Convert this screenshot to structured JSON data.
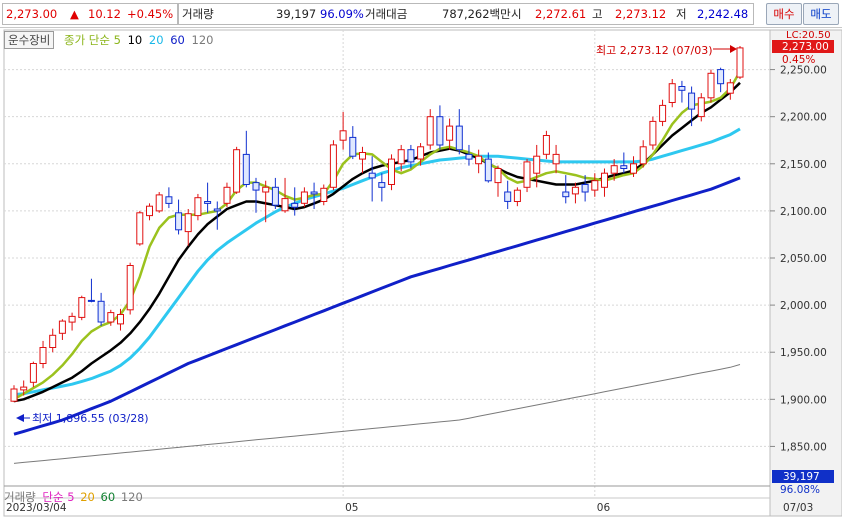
{
  "quote": {
    "price": "2,273.00",
    "arrow": "▲",
    "change": "10.12",
    "change_pct": "+0.45%",
    "volume_label": "거래량",
    "volume": "39,197",
    "volume_ratio": "96.09%",
    "value_label": "거래대금",
    "value": "787,262백만",
    "open_label": "시",
    "open": "2,272.61",
    "high_label": "고",
    "high": "2,273.12",
    "low_label": "저",
    "low": "2,242.48",
    "buy_label": "매수",
    "sell_label": "매도"
  },
  "legend": {
    "sector": "운수장비",
    "price_ma_label": "종가 단순",
    "periods": [
      "5",
      "10",
      "20",
      "60",
      "120"
    ],
    "volume_label": "거래량",
    "volume_ma_label": "단순",
    "volume_periods": [
      "5",
      "20",
      "60",
      "120"
    ]
  },
  "annotations": {
    "high_note": "최고 2,273.12 (07/03)",
    "low_note": "최저 1,896.55 (03/28)",
    "lc_label": "LC:20.50",
    "current_tag": "2,273.00",
    "current_pct": "0.45%",
    "vol_tag": "39,197",
    "vol_pct": "96.08%"
  },
  "colors": {
    "up": "#e01010",
    "down": "#1030d0",
    "ma5": "#9bc21e",
    "ma10": "#000000",
    "ma20": "#2ec8f0",
    "ma60": "#1020c8",
    "ma120": "#7a7a7a"
  },
  "chart_data": {
    "type": "candlestick",
    "title": "운수장비",
    "x_start": "2023/03/04",
    "x_ticks": [
      {
        "label": "2023/03/04",
        "index": 0
      },
      {
        "label": "05",
        "index": 34
      },
      {
        "label": "06",
        "index": 60
      },
      {
        "label": "07",
        "index": 87
      }
    ],
    "x_end_label": "07/03",
    "ylim": [
      1808,
      2292
    ],
    "y_ticks": [
      1850,
      1900,
      1950,
      2000,
      2050,
      2100,
      2150,
      2200,
      2250
    ],
    "y_tick_labels": [
      "1,850.00",
      "1,900.00",
      "1,950.00",
      "2,000.00",
      "2,050.00",
      "2,100.00",
      "2,150.00",
      "2,200.00",
      "2,250.00"
    ],
    "candles": [
      [
        1898,
        1915,
        1897,
        1911
      ],
      [
        1910,
        1920,
        1904,
        1913
      ],
      [
        1918,
        1940,
        1913,
        1938
      ],
      [
        1938,
        1962,
        1933,
        1955
      ],
      [
        1955,
        1975,
        1950,
        1968
      ],
      [
        1970,
        1985,
        1963,
        1983
      ],
      [
        1982,
        1992,
        1973,
        1988
      ],
      [
        1987,
        2010,
        1984,
        2008
      ],
      [
        2005,
        2028,
        2003,
        2004
      ],
      [
        2004,
        2013,
        1978,
        1982
      ],
      [
        1982,
        1995,
        1978,
        1992
      ],
      [
        1980,
        1996,
        1973,
        1990
      ],
      [
        1995,
        2045,
        1990,
        2042
      ],
      [
        2065,
        2100,
        2063,
        2098
      ],
      [
        2095,
        2108,
        2090,
        2105
      ],
      [
        2100,
        2120,
        2098,
        2117
      ],
      [
        2115,
        2125,
        2103,
        2108
      ],
      [
        2098,
        2112,
        2075,
        2080
      ],
      [
        2078,
        2102,
        2063,
        2097
      ],
      [
        2095,
        2118,
        2090,
        2114
      ],
      [
        2110,
        2130,
        2098,
        2108
      ],
      [
        2102,
        2110,
        2080,
        2100
      ],
      [
        2108,
        2130,
        2104,
        2125
      ],
      [
        2120,
        2168,
        2118,
        2165
      ],
      [
        2160,
        2185,
        2125,
        2128
      ],
      [
        2130,
        2135,
        2098,
        2122
      ],
      [
        2120,
        2132,
        2088,
        2125
      ],
      [
        2125,
        2135,
        2102,
        2106
      ],
      [
        2100,
        2135,
        2098,
        2113
      ],
      [
        2108,
        2125,
        2095,
        2104
      ],
      [
        2108,
        2125,
        2104,
        2120
      ],
      [
        2120,
        2130,
        2102,
        2118
      ],
      [
        2110,
        2128,
        2106,
        2124
      ],
      [
        2125,
        2175,
        2122,
        2170
      ],
      [
        2175,
        2205,
        2165,
        2185
      ],
      [
        2178,
        2190,
        2155,
        2158
      ],
      [
        2155,
        2168,
        2140,
        2162
      ],
      [
        2140,
        2158,
        2110,
        2135
      ],
      [
        2130,
        2140,
        2110,
        2125
      ],
      [
        2128,
        2160,
        2122,
        2155
      ],
      [
        2150,
        2170,
        2142,
        2165
      ],
      [
        2165,
        2170,
        2145,
        2152
      ],
      [
        2155,
        2172,
        2148,
        2168
      ],
      [
        2170,
        2208,
        2165,
        2200
      ],
      [
        2200,
        2212,
        2165,
        2170
      ],
      [
        2175,
        2198,
        2165,
        2190
      ],
      [
        2190,
        2208,
        2160,
        2165
      ],
      [
        2160,
        2170,
        2148,
        2155
      ],
      [
        2150,
        2165,
        2140,
        2158
      ],
      [
        2155,
        2162,
        2130,
        2132
      ],
      [
        2130,
        2148,
        2115,
        2145
      ],
      [
        2120,
        2132,
        2102,
        2110
      ],
      [
        2110,
        2125,
        2105,
        2122
      ],
      [
        2125,
        2155,
        2120,
        2152
      ],
      [
        2140,
        2170,
        2125,
        2158
      ],
      [
        2160,
        2185,
        2155,
        2180
      ],
      [
        2150,
        2170,
        2140,
        2160
      ],
      [
        2120,
        2138,
        2108,
        2115
      ],
      [
        2118,
        2130,
        2108,
        2125
      ],
      [
        2128,
        2138,
        2110,
        2120
      ],
      [
        2122,
        2140,
        2115,
        2132
      ],
      [
        2125,
        2145,
        2115,
        2140
      ],
      [
        2140,
        2155,
        2132,
        2148
      ],
      [
        2148,
        2162,
        2140,
        2145
      ],
      [
        2140,
        2158,
        2136,
        2150
      ],
      [
        2150,
        2175,
        2146,
        2168
      ],
      [
        2170,
        2200,
        2165,
        2195
      ],
      [
        2195,
        2218,
        2190,
        2212
      ],
      [
        2215,
        2240,
        2210,
        2235
      ],
      [
        2232,
        2238,
        2215,
        2228
      ],
      [
        2225,
        2232,
        2190,
        2208
      ],
      [
        2200,
        2225,
        2195,
        2220
      ],
      [
        2220,
        2250,
        2215,
        2246
      ],
      [
        2250,
        2252,
        2226,
        2235
      ],
      [
        2225,
        2240,
        2218,
        2236
      ],
      [
        2242,
        2275,
        2240,
        2273
      ]
    ],
    "ma5": [
      1900,
      1906,
      1912,
      1918,
      1926,
      1936,
      1948,
      1962,
      1972,
      1978,
      1982,
      1990,
      2005,
      2030,
      2062,
      2082,
      2093,
      2096,
      2096,
      2096,
      2098,
      2100,
      2108,
      2122,
      2130,
      2130,
      2126,
      2122,
      2116,
      2112,
      2114,
      2117,
      2118,
      2132,
      2150,
      2160,
      2161,
      2160,
      2152,
      2144,
      2140,
      2144,
      2152,
      2160,
      2166,
      2168,
      2165,
      2162,
      2158,
      2150,
      2145,
      2135,
      2130,
      2132,
      2136,
      2140,
      2142,
      2140,
      2138,
      2135,
      2134,
      2132,
      2135,
      2138,
      2140,
      2148,
      2160,
      2175,
      2192,
      2204,
      2212,
      2214,
      2216,
      2220,
      2230,
      2248
    ],
    "ma10": [
      1898,
      1900,
      1904,
      1908,
      1913,
      1918,
      1923,
      1930,
      1938,
      1945,
      1952,
      1960,
      1970,
      1982,
      1996,
      2012,
      2030,
      2048,
      2062,
      2075,
      2086,
      2094,
      2102,
      2106,
      2110,
      2110,
      2108,
      2106,
      2104,
      2102,
      2104,
      2108,
      2112,
      2118,
      2126,
      2134,
      2140,
      2145,
      2148,
      2150,
      2152,
      2154,
      2158,
      2162,
      2164,
      2166,
      2164,
      2160,
      2156,
      2150,
      2145,
      2140,
      2136,
      2134,
      2132,
      2130,
      2128,
      2128,
      2128,
      2130,
      2132,
      2135,
      2138,
      2140,
      2143,
      2150,
      2160,
      2170,
      2180,
      2188,
      2196,
      2204,
      2210,
      2218,
      2226,
      2236
    ],
    "ma20": [
      1905,
      1906,
      1908,
      1910,
      1912,
      1914,
      1916,
      1919,
      1922,
      1926,
      1930,
      1936,
      1944,
      1954,
      1966,
      1980,
      1994,
      2008,
      2022,
      2036,
      2048,
      2058,
      2066,
      2073,
      2080,
      2087,
      2093,
      2099,
      2104,
      2108,
      2112,
      2115,
      2118,
      2121,
      2124,
      2128,
      2132,
      2136,
      2140,
      2143,
      2146,
      2148,
      2150,
      2152,
      2154,
      2155,
      2156,
      2157,
      2158,
      2158,
      2158,
      2157,
      2156,
      2155,
      2154,
      2153,
      2152,
      2152,
      2152,
      2152,
      2152,
      2152,
      2152,
      2152,
      2152,
      2153,
      2155,
      2158,
      2161,
      2164,
      2167,
      2170,
      2173,
      2177,
      2181,
      2187
    ],
    "ma60": [
      1863,
      1866,
      1869,
      1872,
      1875,
      1878,
      1882,
      1886,
      1890,
      1894,
      1898,
      1903,
      1908,
      1913,
      1918,
      1923,
      1928,
      1933,
      1938,
      1942,
      1946,
      1950,
      1954,
      1958,
      1962,
      1966,
      1970,
      1974,
      1978,
      1982,
      1986,
      1990,
      1994,
      1998,
      2002,
      2006,
      2010,
      2014,
      2018,
      2022,
      2026,
      2030,
      2033,
      2036,
      2039,
      2042,
      2045,
      2048,
      2051,
      2054,
      2057,
      2060,
      2063,
      2066,
      2069,
      2072,
      2075,
      2078,
      2081,
      2084,
      2087,
      2090,
      2093,
      2096,
      2099,
      2102,
      2105,
      2108,
      2111,
      2114,
      2117,
      2120,
      2123,
      2127,
      2131,
      2135
    ],
    "ma120": [
      1832,
      1833,
      1834,
      1835,
      1836,
      1837,
      1838,
      1839,
      1840,
      1841,
      1842,
      1843,
      1844,
      1845,
      1846,
      1847,
      1848,
      1849,
      1850,
      1851,
      1852,
      1853,
      1854,
      1855,
      1856,
      1857,
      1858,
      1859,
      1860,
      1861,
      1862,
      1863,
      1864,
      1865,
      1866,
      1867,
      1868,
      1869,
      1870,
      1871,
      1872,
      1873,
      1874,
      1875,
      1876,
      1877,
      1878,
      1880,
      1882,
      1884,
      1886,
      1888,
      1890,
      1892,
      1894,
      1896,
      1898,
      1900,
      1902,
      1904,
      1906,
      1908,
      1910,
      1912,
      1914,
      1916,
      1918,
      1920,
      1922,
      1924,
      1926,
      1928,
      1930,
      1932,
      1934,
      1937
    ]
  }
}
